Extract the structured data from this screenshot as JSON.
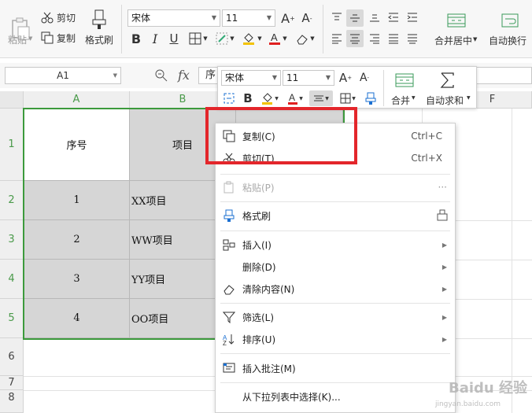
{
  "ribbon": {
    "paste_label": "粘贴",
    "cut_label": "剪切",
    "copy_label": "复制",
    "format_painter_label": "格式刷",
    "font_name": "宋体",
    "font_size": "11",
    "merge_center_label": "合并居中",
    "wrap_text_label": "自动换行"
  },
  "formula_bar": {
    "name_box": "A1",
    "fx_label": "fx",
    "content": "序"
  },
  "columns": [
    "A",
    "B",
    "F"
  ],
  "rows": [
    "1",
    "2",
    "3",
    "4",
    "5",
    "6",
    "7",
    "8"
  ],
  "table": {
    "header": [
      "序号",
      "项目"
    ],
    "rows": [
      [
        "1",
        "XX项目"
      ],
      [
        "2",
        "WW项目"
      ],
      [
        "3",
        "YY项目"
      ],
      [
        "4",
        "OO项目"
      ]
    ]
  },
  "mini_toolbar": {
    "font_name": "宋体",
    "font_size": "11",
    "merge_label": "合并",
    "autosum_label": "自动求和"
  },
  "context_menu": {
    "copy": {
      "label": "复制(C)",
      "shortcut": "Ctrl+C"
    },
    "cut": {
      "label": "剪切(T)",
      "shortcut": "Ctrl+X"
    },
    "paste": {
      "label": "粘贴(P)",
      "more": "···"
    },
    "format_painter": {
      "label": "格式刷"
    },
    "insert": {
      "label": "插入(I)"
    },
    "delete": {
      "label": "删除(D)"
    },
    "clear": {
      "label": "清除内容(N)"
    },
    "filter": {
      "label": "筛选(L)"
    },
    "sort": {
      "label": "排序(U)"
    },
    "comment": {
      "label": "插入批注(M)"
    },
    "pick_list": {
      "label": "从下拉列表中选择(K)..."
    }
  },
  "watermark": {
    "logo": "Baidu 经验",
    "url": "jingyan.baidu.com"
  },
  "colors": {
    "selection": "#3c9a3c",
    "highlight": "#e3262b",
    "selected_cells": "#d6d6d6"
  }
}
